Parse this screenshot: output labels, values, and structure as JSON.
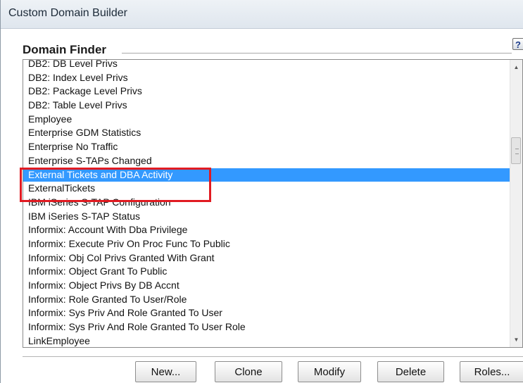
{
  "window": {
    "title": "Custom Domain Builder"
  },
  "section": {
    "title": "Domain Finder",
    "help_icon": "help-icon",
    "help_glyph": "?"
  },
  "list": {
    "items": [
      {
        "label": "DB2: DB Level Privs",
        "selected": false
      },
      {
        "label": "DB2: Index Level Privs",
        "selected": false
      },
      {
        "label": "DB2: Package Level Privs",
        "selected": false
      },
      {
        "label": "DB2: Table Level Privs",
        "selected": false
      },
      {
        "label": "Employee",
        "selected": false
      },
      {
        "label": "Enterprise GDM Statistics",
        "selected": false
      },
      {
        "label": "Enterprise No Traffic",
        "selected": false
      },
      {
        "label": "Enterprise S-TAPs Changed",
        "selected": false
      },
      {
        "label": "External Tickets and DBA Activity",
        "selected": true
      },
      {
        "label": "ExternalTickets",
        "selected": false
      },
      {
        "label": "IBM iSeries S-TAP Configuration",
        "selected": false
      },
      {
        "label": "IBM iSeries S-TAP Status",
        "selected": false
      },
      {
        "label": "Informix: Account With Dba Privilege",
        "selected": false
      },
      {
        "label": "Informix: Execute Priv On Proc Func To Public",
        "selected": false
      },
      {
        "label": "Informix: Obj Col Privs Granted With Grant",
        "selected": false
      },
      {
        "label": "Informix: Object Grant To Public",
        "selected": false
      },
      {
        "label": "Informix: Object Privs By DB Accnt",
        "selected": false
      },
      {
        "label": "Informix: Role Granted To User/Role",
        "selected": false
      },
      {
        "label": "Informix: Sys Priv And Role Granted To User",
        "selected": false
      },
      {
        "label": "Informix: Sys Priv And Role Granted To User Role",
        "selected": false
      },
      {
        "label": "LinkEmployee",
        "selected": false
      }
    ],
    "selection_color": "#3399ff",
    "highlight_color": "#e11b22"
  },
  "scrollbar": {
    "up_glyph": "▲",
    "down_glyph": "▼"
  },
  "buttons": {
    "new": "New...",
    "clone": "Clone",
    "modify": "Modify",
    "delete": "Delete",
    "roles": "Roles..."
  }
}
